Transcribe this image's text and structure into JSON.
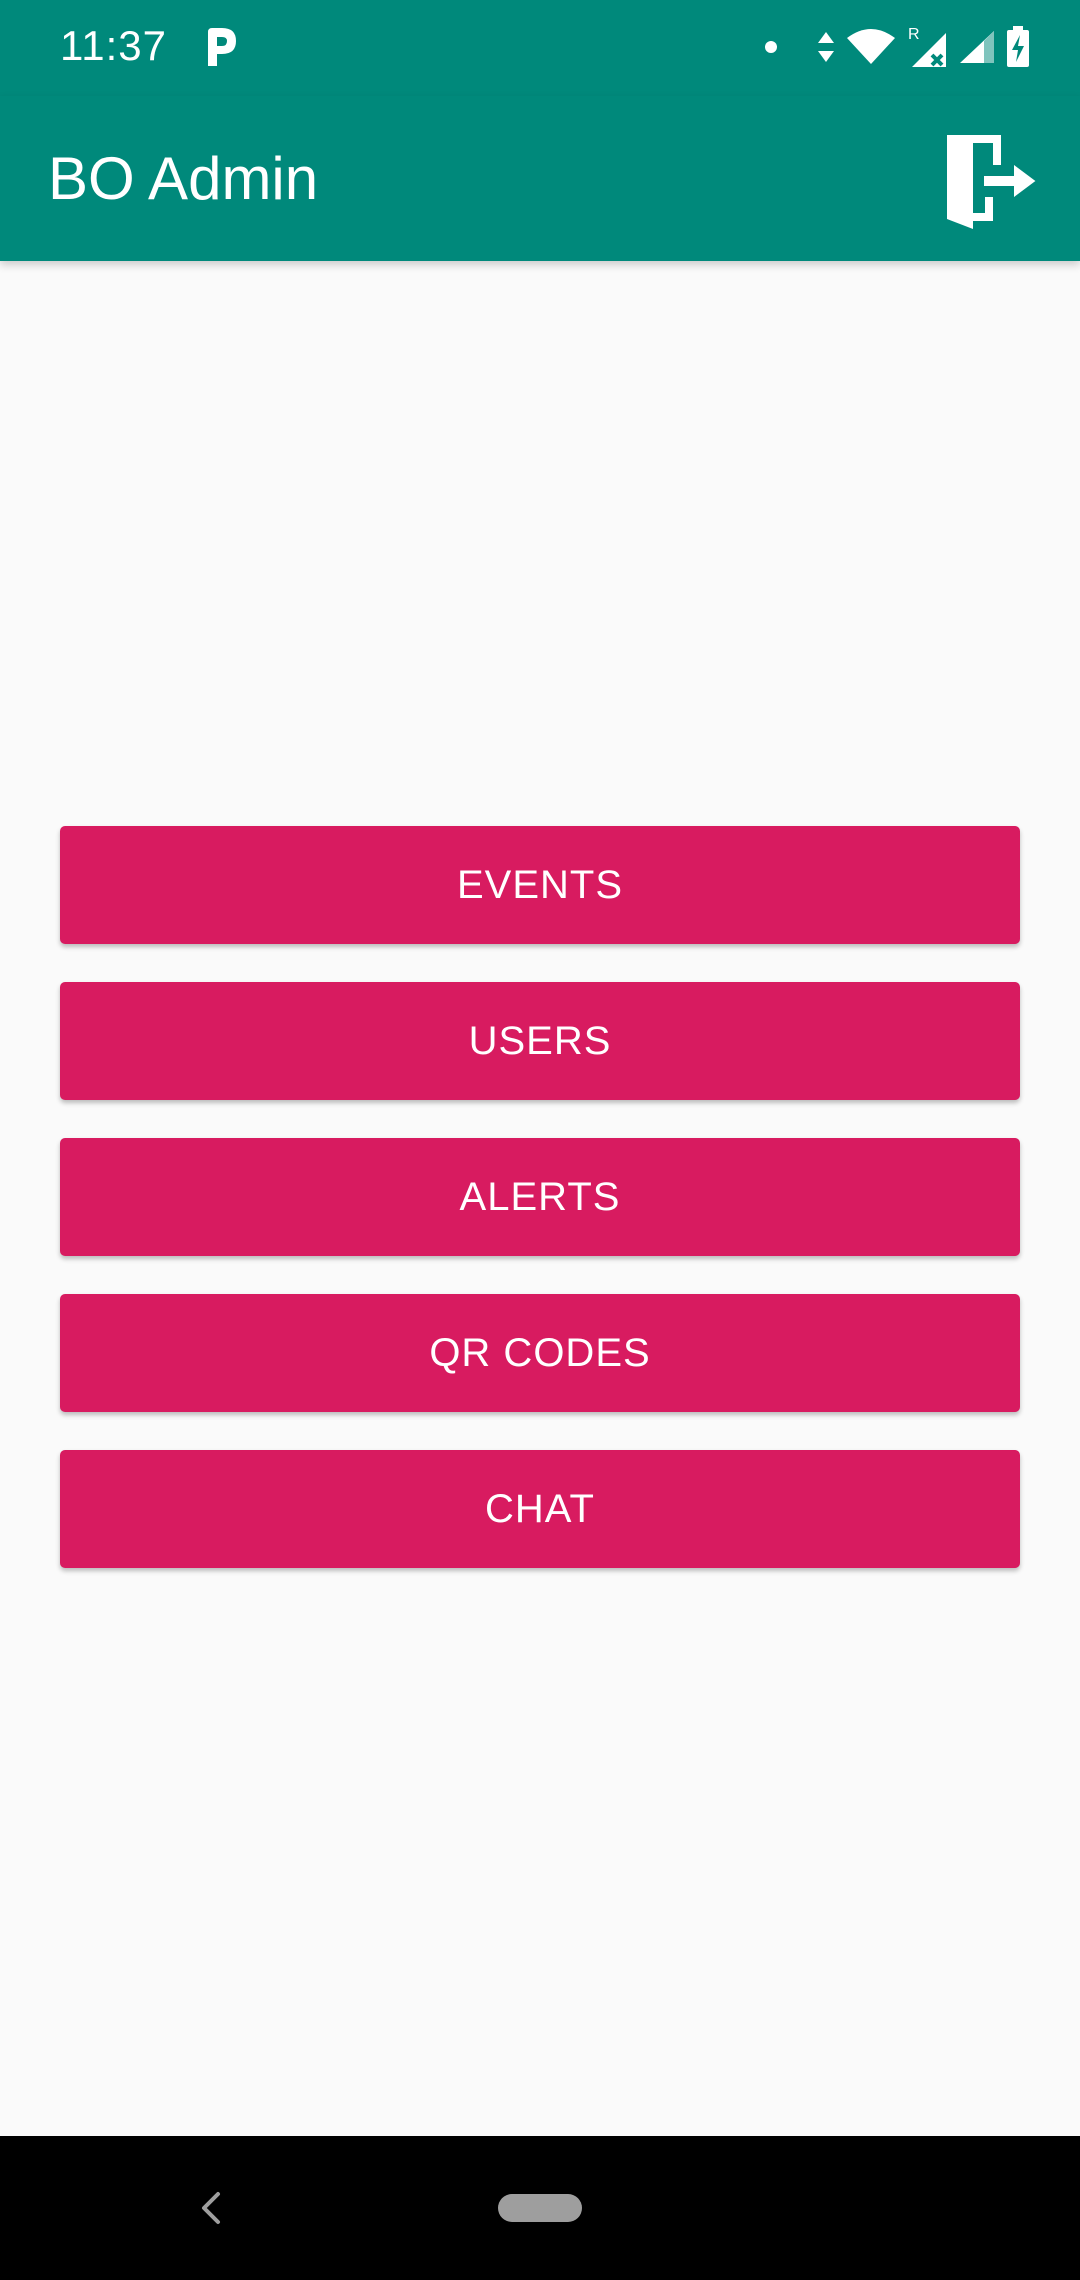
{
  "status_bar": {
    "time": "11:37",
    "icons": [
      "parking-icon",
      "notification-dot-icon",
      "data-arrows-icon",
      "wifi-icon",
      "roaming-signal-icon",
      "signal-icon",
      "battery-charging-icon"
    ],
    "roaming_indicator": "R",
    "color": "#00897b"
  },
  "app_bar": {
    "title": "BO Admin",
    "action_icon": "logout-icon",
    "color": "#00897b"
  },
  "menu": {
    "button_color": "#d81b60",
    "buttons": [
      {
        "label": "EVENTS"
      },
      {
        "label": "USERS"
      },
      {
        "label": "ALERTS"
      },
      {
        "label": "QR CODES"
      },
      {
        "label": "CHAT"
      }
    ]
  },
  "nav_bar": {
    "icons": [
      "back-icon",
      "home-pill-icon"
    ]
  }
}
